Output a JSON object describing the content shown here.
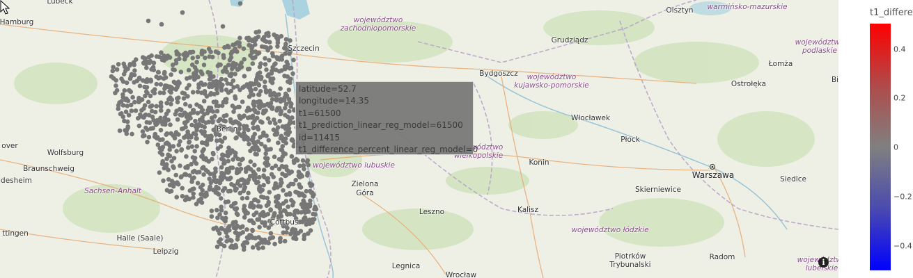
{
  "map": {
    "city_labels": [
      {
        "name": "Lübeck",
        "kind": "city"
      },
      {
        "name": "Hamburg",
        "kind": "city"
      },
      {
        "name": "Szczecin",
        "kind": "city"
      },
      {
        "name": "Bydgoszcz",
        "kind": "city"
      },
      {
        "name": "Grudziądz",
        "kind": "city"
      },
      {
        "name": "Olsztyn",
        "kind": "city"
      },
      {
        "name": "Łomża",
        "kind": "city"
      },
      {
        "name": "Ostrołęka",
        "kind": "city"
      },
      {
        "name": "Bi",
        "kind": "city"
      },
      {
        "name": "Włocławek",
        "kind": "city"
      },
      {
        "name": "Płock",
        "kind": "city"
      },
      {
        "name": "Warszawa",
        "kind": "capital"
      },
      {
        "name": "Siedlce",
        "kind": "city"
      },
      {
        "name": "Skierniewice",
        "kind": "city"
      },
      {
        "name": "Konin",
        "kind": "city"
      },
      {
        "name": "Kalisz",
        "kind": "city"
      },
      {
        "name": "Leszno",
        "kind": "city"
      },
      {
        "name": "Zielona Góra",
        "kind": "city"
      },
      {
        "name": "Legnica",
        "kind": "city"
      },
      {
        "name": "Wrocław",
        "kind": "city"
      },
      {
        "name": "Piotrków Trybunalski",
        "kind": "city"
      },
      {
        "name": "Radom",
        "kind": "city"
      },
      {
        "name": "Wolfsburg",
        "kind": "city"
      },
      {
        "name": "over",
        "kind": "city"
      },
      {
        "name": "Braunschweig",
        "kind": "city"
      },
      {
        "name": "ldesheim",
        "kind": "city"
      },
      {
        "name": "ttingen",
        "kind": "city"
      },
      {
        "name": "Halle (Saale)",
        "kind": "city"
      },
      {
        "name": "Leipzig",
        "kind": "city"
      },
      {
        "name": "Berlin",
        "kind": "city"
      },
      {
        "name": "Cottbus",
        "kind": "city"
      }
    ],
    "region_labels": [
      "województwo zachodniopomorskie",
      "województwo kujawsko-pomorskie",
      "warmińsko-mazurskie",
      "województwo podlaskie",
      "województwo wielkopolskie",
      "województwo lubuskie",
      "Sachsen-Anhalt",
      "województwo łódzkie",
      "województwo lubelskie"
    ],
    "point_color": "#777777",
    "info_icon": "info-icon"
  },
  "tooltip": {
    "lines": [
      "latitude=52.7",
      "longitude=14.35",
      "t1=61500",
      "t1_prediction_linear_reg_model=61500",
      "id=11415",
      "t1_difference_percent_linear_reg_model=0"
    ]
  },
  "colorbar": {
    "title": "t1_differe",
    "title_faded": "e",
    "ticks": [
      "0.4",
      "0.2",
      "0",
      "−0.2",
      "−0.4"
    ],
    "colors": {
      "max": "#ff0000",
      "mid": "#808080",
      "min": "#0000ff"
    }
  }
}
